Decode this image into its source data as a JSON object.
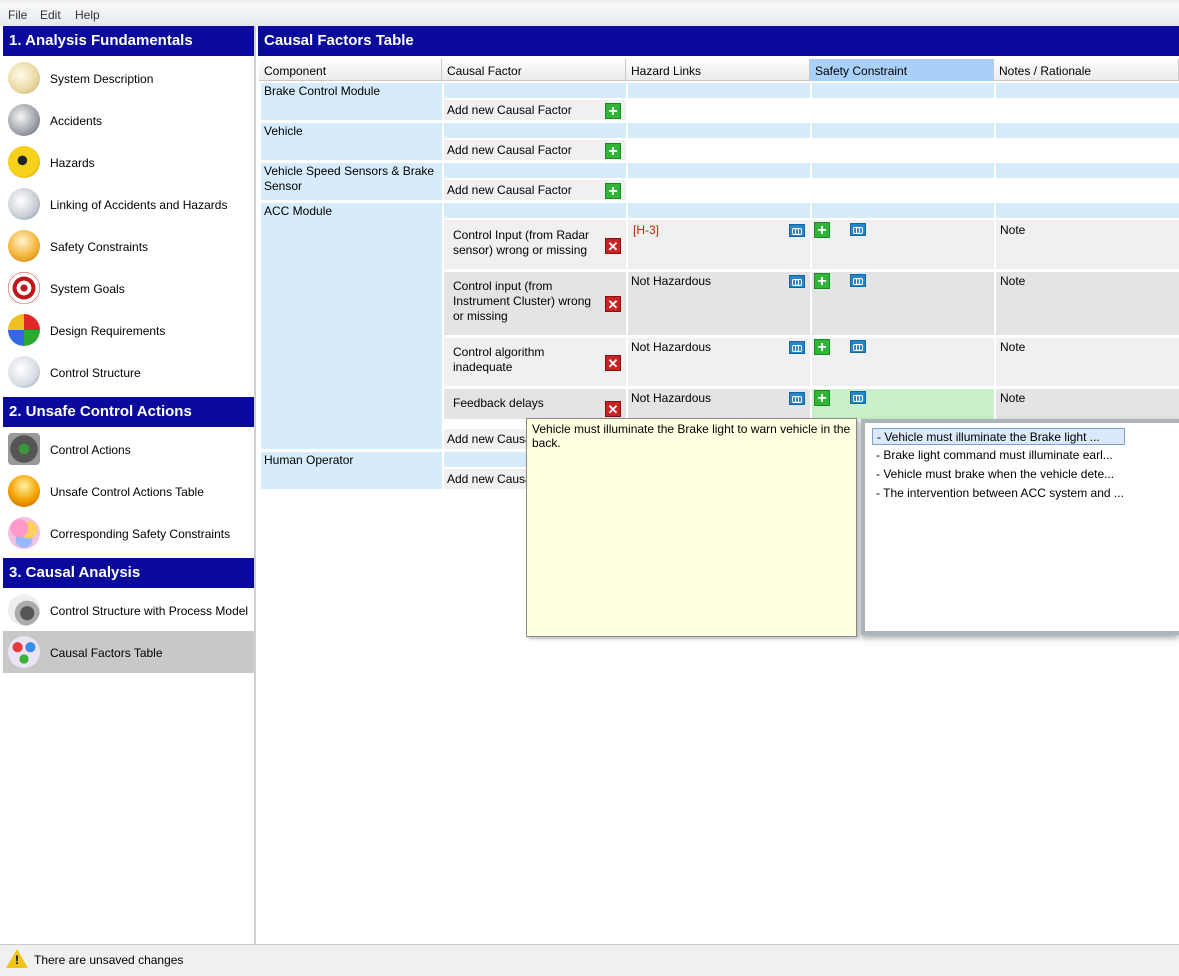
{
  "menu": [
    "File",
    "Edit",
    "Help"
  ],
  "sidebar": {
    "sections": [
      {
        "title": "1. Analysis Fundamentals",
        "items": [
          {
            "label": "System Description",
            "icon": "edit-document-icon"
          },
          {
            "label": "Accidents",
            "icon": "accident-building-icon"
          },
          {
            "label": "Hazards",
            "icon": "radiation-warning-icon"
          },
          {
            "label": "Linking of Accidents and Hazards",
            "icon": "link-chain-icon"
          },
          {
            "label": "Safety Constraints",
            "icon": "worker-helmet-icon"
          },
          {
            "label": "System Goals",
            "icon": "target-icon"
          },
          {
            "label": "Design Requirements",
            "icon": "puzzle-icon"
          },
          {
            "label": "Control Structure",
            "icon": "structure-diagram-icon"
          }
        ]
      },
      {
        "title": "2. Unsafe Control Actions",
        "items": [
          {
            "label": "Control Actions",
            "icon": "control-panel-icon"
          },
          {
            "label": "Unsafe Control Actions Table",
            "icon": "alarm-light-icon"
          },
          {
            "label": "Corresponding Safety Constraints",
            "icon": "circles-icon"
          }
        ]
      },
      {
        "title": "3. Causal Analysis",
        "items": [
          {
            "label": "Control Structure with Process Model",
            "icon": "gear-document-icon"
          },
          {
            "label": "Causal Factors Table",
            "icon": "causal-network-icon"
          }
        ]
      }
    ],
    "selected": "Causal Factors Table"
  },
  "main": {
    "title": "Causal Factors Table",
    "columns": [
      "Component",
      "Causal Factor",
      "Hazard Links",
      "Safety Constraint",
      "Notes / Rationale"
    ],
    "active_column": "Safety Constraint",
    "add_label": "Add new Causal Factor",
    "add_label_truncated": "Add new Causa",
    "components": [
      {
        "name": "Brake Control Module"
      },
      {
        "name": "Vehicle"
      },
      {
        "name": "Vehicle Speed Sensors & Brake Sensor"
      },
      {
        "name": "ACC Module"
      },
      {
        "name": "Human Operator"
      }
    ],
    "acc_factors": [
      {
        "text": "Control Input (from Radar sensor) wrong or missing",
        "hazard": "[H-3]",
        "note": "Note"
      },
      {
        "text": "Control input (from Instrument Cluster) wrong or missing",
        "hazard": "Not Hazardous",
        "note": "Note"
      },
      {
        "text": "Control algorithm inadequate",
        "hazard": "Not Hazardous",
        "note": "Note"
      },
      {
        "text": "Feedback delays",
        "hazard": "Not Hazardous",
        "note": "Note"
      }
    ]
  },
  "tooltip": {
    "text": "Vehicle must illuminate the Brake light to warn vehicle in the back."
  },
  "dropdown": {
    "items": [
      "- Vehicle must illuminate the Brake light ...",
      "- Brake light command must illuminate earl...",
      "- Vehicle must brake when the vehicle dete...",
      "- The intervention between ACC system and ..."
    ],
    "selected_index": 0
  },
  "status": {
    "text": "There are unsaved changes"
  },
  "colors": {
    "header_blue": "#0a0a9c",
    "cell_blue": "#d6ecfb",
    "add_green": "#2fb538",
    "delete_red": "#c62424",
    "link_blue": "#2587c9",
    "hazard_red": "#cc2200",
    "tooltip_yellow": "#ffffe1"
  }
}
